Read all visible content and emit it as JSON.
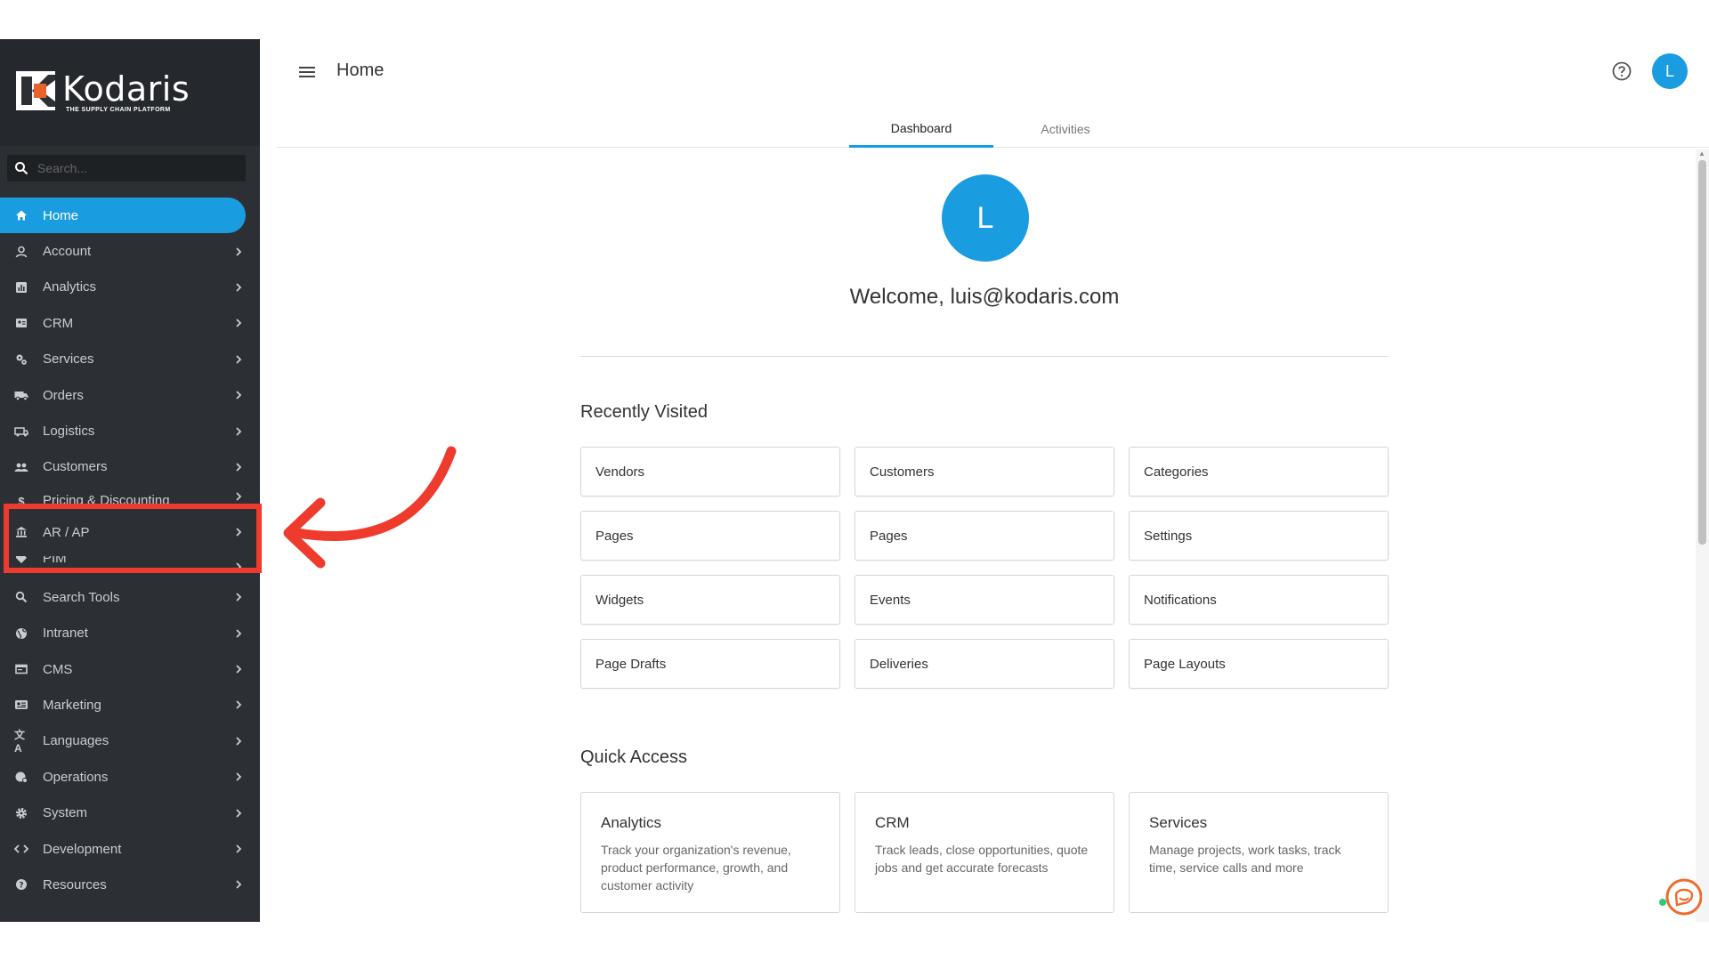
{
  "brand": {
    "name": "Kodaris",
    "tagline": "THE SUPPLY CHAIN PLATFORM"
  },
  "search": {
    "placeholder": "Search..."
  },
  "nav": [
    {
      "label": "Home",
      "icon": "home-icon",
      "active": true
    },
    {
      "label": "Account",
      "icon": "person-icon"
    },
    {
      "label": "Analytics",
      "icon": "chart-icon"
    },
    {
      "label": "CRM",
      "icon": "contact-card-icon"
    },
    {
      "label": "Services",
      "icon": "gears-icon"
    },
    {
      "label": "Orders",
      "icon": "truck-icon"
    },
    {
      "label": "Logistics",
      "icon": "delivery-van-icon"
    },
    {
      "label": "Customers",
      "icon": "people-icon"
    },
    {
      "label": "Pricing & Discounting",
      "icon": "dollar-icon"
    },
    {
      "label": "AR / AP",
      "icon": "bank-icon"
    },
    {
      "label": "PIM",
      "icon": "tag-icon"
    },
    {
      "label": "Search Tools",
      "icon": "search-icon"
    },
    {
      "label": "Intranet",
      "icon": "globe-icon"
    },
    {
      "label": "CMS",
      "icon": "window-icon"
    },
    {
      "label": "Marketing",
      "icon": "megaphone-icon"
    },
    {
      "label": "Languages",
      "icon": "translate-icon"
    },
    {
      "label": "Operations",
      "icon": "operations-icon"
    },
    {
      "label": "System",
      "icon": "gear-icon"
    },
    {
      "label": "Development",
      "icon": "code-icon"
    },
    {
      "label": "Resources",
      "icon": "help-circle-icon"
    }
  ],
  "header": {
    "title": "Home",
    "avatar_initial": "L"
  },
  "tabs": [
    {
      "label": "Dashboard",
      "active": true
    },
    {
      "label": "Activities",
      "active": false
    }
  ],
  "profile": {
    "initial": "L",
    "welcome": "Welcome, luis@kodaris.com"
  },
  "recently_visited": {
    "title": "Recently Visited",
    "items": [
      "Vendors",
      "Customers",
      "Categories",
      "Pages",
      "Pages",
      "Settings",
      "Widgets",
      "Events",
      "Notifications",
      "Page Drafts",
      "Deliveries",
      "Page Layouts"
    ]
  },
  "quick_access": {
    "title": "Quick Access",
    "items": [
      {
        "title": "Analytics",
        "desc": "Track your organization's revenue, product performance, growth, and customer activity"
      },
      {
        "title": "CRM",
        "desc": "Track leads, close opportunities, quote jobs and get accurate forecasts"
      },
      {
        "title": "Services",
        "desc": "Manage projects, work tasks, track time, service calls and more"
      }
    ]
  },
  "colors": {
    "accent": "#1a9ce0",
    "sidebar": "#2c3034",
    "highlight": "#ef3b2d"
  }
}
